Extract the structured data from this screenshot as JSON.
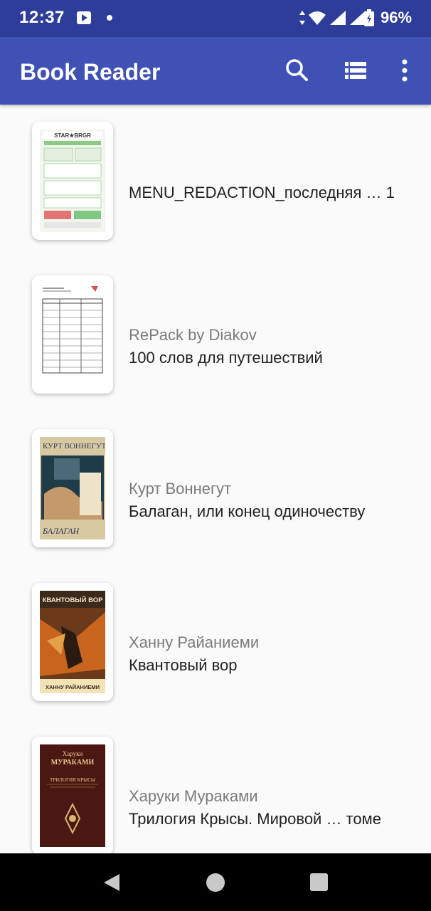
{
  "status_bar": {
    "time": "12:37",
    "battery": "96%"
  },
  "app_bar": {
    "title": "Book Reader"
  },
  "books": [
    {
      "author": "",
      "title": "MENU_REDACTION_последняя … 1"
    },
    {
      "author": "RePack by Diakov",
      "title": "100 слов для путешествий"
    },
    {
      "author": "Курт Воннегут",
      "title": "Балаган, или конец одиночеству"
    },
    {
      "author": "Ханну Райаниеми",
      "title": "Квантовый вор"
    },
    {
      "author": "Харуки Мураками",
      "title": "Трилогия Крысы. Мировой … томе"
    }
  ],
  "covers": {
    "menu": {
      "brand": "STAR★BRGR"
    },
    "vonnegut": {
      "author": "КУРТ ВОННЕГУТ",
      "title": "БАЛАГАН"
    },
    "quantum": {
      "title": "КВАНТОВЫЙ ВОР",
      "author": "ХАННУ РАЙАНИЕМИ"
    },
    "murakami": {
      "author_line1": "Харуки",
      "author_line2": "МУРАКАМИ",
      "title": "ТРИЛОГИЯ КРЫСЫ"
    }
  }
}
